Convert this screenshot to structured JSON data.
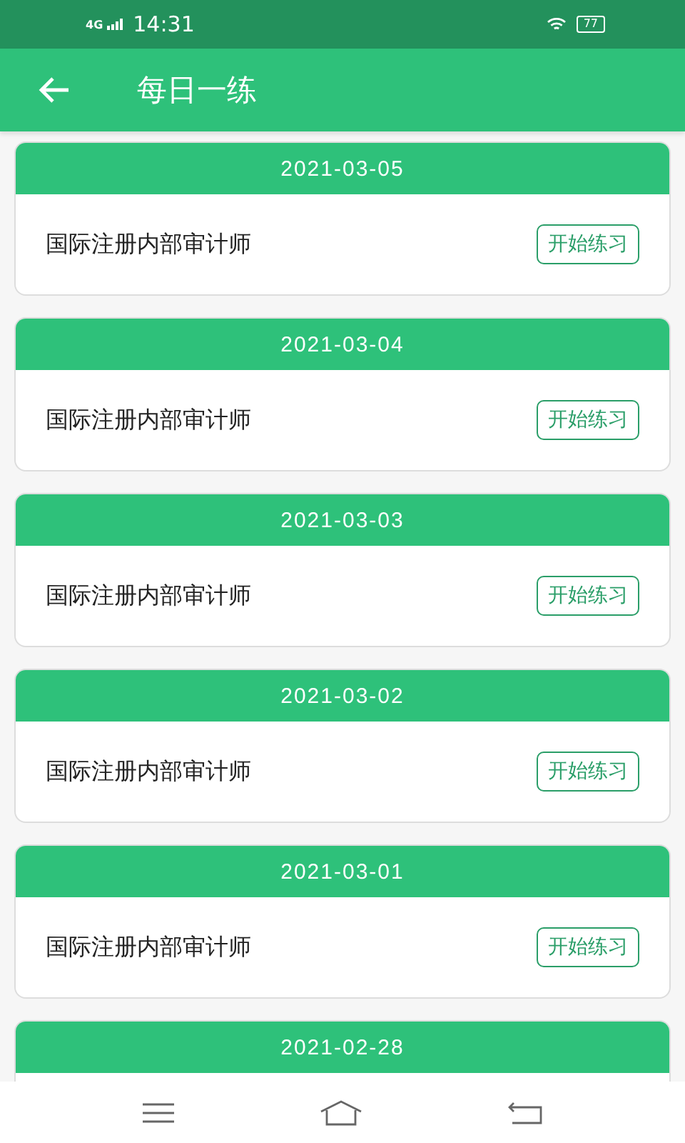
{
  "status_bar": {
    "network": "4G",
    "time": "14:31",
    "battery": "77"
  },
  "header": {
    "title": "每日一练"
  },
  "cards": [
    {
      "date": "2021-03-05",
      "title": "国际注册内部审计师",
      "button": "开始练习"
    },
    {
      "date": "2021-03-04",
      "title": "国际注册内部审计师",
      "button": "开始练习"
    },
    {
      "date": "2021-03-03",
      "title": "国际注册内部审计师",
      "button": "开始练习"
    },
    {
      "date": "2021-03-02",
      "title": "国际注册内部审计师",
      "button": "开始练习"
    },
    {
      "date": "2021-03-01",
      "title": "国际注册内部审计师",
      "button": "开始练习"
    },
    {
      "date": "2021-02-28"
    }
  ]
}
